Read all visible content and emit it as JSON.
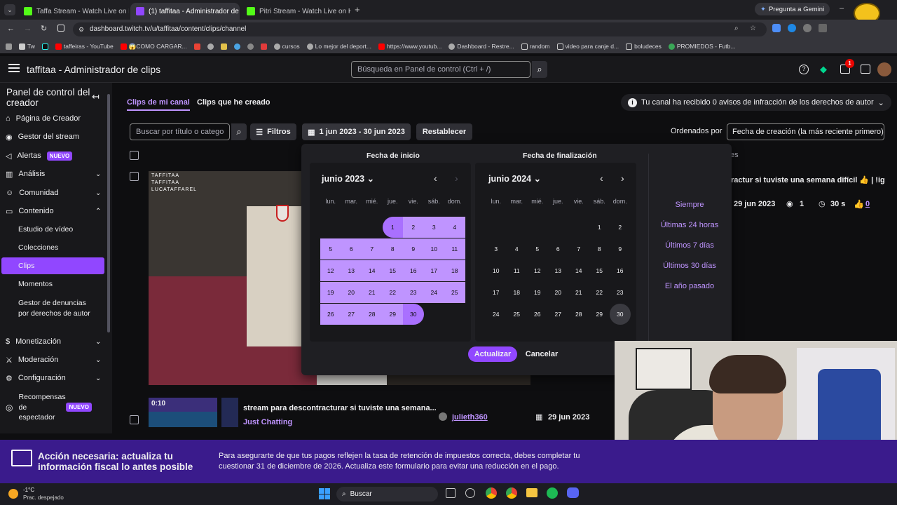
{
  "browser": {
    "tabs": [
      {
        "label": "Taffa Stream - Watch Live on Ki",
        "active": false,
        "color": "#53fc18"
      },
      {
        "label": "(1) taffitaa - Administrador de c",
        "active": true,
        "color": "#9147ff"
      },
      {
        "label": "Pitri Stream - Watch Live on Ki",
        "active": false,
        "color": "#53fc18"
      }
    ],
    "gemini_label": "Pregunta a Gemini",
    "url": "dashboard.twitch.tv/u/taffitaa/content/clips/channel",
    "bookmarks": [
      "Tw",
      "taffeiras - YouTube",
      "😱COMO CARGAR...",
      "cursos",
      "Lo mejor del deport...",
      "https://www.youtub...",
      "Dashboard - Restre...",
      "random",
      "video para canje d...",
      "boludeces",
      "PROMIEDOS - Futb..."
    ]
  },
  "topnav": {
    "title": "taffitaa - Administrador de clips",
    "search_placeholder": "Búsqueda en Panel de control (Ctrl + /)",
    "notification_count": "1"
  },
  "sidebar": {
    "title": "Panel de control del creador",
    "items": [
      {
        "label": "Página de Creador"
      },
      {
        "label": "Gestor del stream"
      },
      {
        "label": "Alertas",
        "badge": "NUEVO"
      },
      {
        "label": "Análisis"
      },
      {
        "label": "Comunidad"
      },
      {
        "label": "Contenido"
      }
    ],
    "subitems": [
      "Estudio de vídeo",
      "Colecciones",
      "Clips",
      "Momentos",
      "Gestor de denuncias por derechos de autor"
    ],
    "items2": [
      {
        "label": "Monetización"
      },
      {
        "label": "Moderación"
      },
      {
        "label": "Configuración"
      },
      {
        "label": "Recompensas de espectador",
        "badge": "NUEVO"
      }
    ]
  },
  "main": {
    "tabs": [
      "Clips de mi canal",
      "Clips que he creado"
    ],
    "copyright_notice": "Tu canal ha recibido 0 avisos de infracción de los derechos de autor",
    "search_placeholder": "Buscar por título o catego",
    "filters_label": "Filtros",
    "date_range": "1 jun 2023 - 30 jun 2023",
    "reset_label": "Restablecer",
    "sort_label": "Ordenados por",
    "sort_value": "Fecha de creación (la más reciente primero)",
    "header_fragment": "es",
    "clip1": {
      "title_fragment": "ractur si tuviste una semana difícil 👍 | !ig",
      "date": "29 jun 2023",
      "views": "1",
      "duration": "30 s",
      "likes": "0"
    },
    "clip2": {
      "duration": "0:10",
      "title": "stream para descontracturar si tuviste una semana...",
      "category": "Just Chatting",
      "creator": "julieth360",
      "date": "29 jun 2023"
    }
  },
  "calendar": {
    "start_label": "Fecha de inicio",
    "end_label": "Fecha de finalización",
    "left_month": "junio 2023",
    "right_month": "junio 2024",
    "weekdays": [
      "lun.",
      "mar.",
      "mié.",
      "jue.",
      "vie.",
      "sáb.",
      "dom."
    ],
    "left_first_weekday": 3,
    "left_days": 30,
    "right_first_weekday": 5,
    "right_days": 30,
    "selected_start": 1,
    "selected_end": 30,
    "presets": [
      "Siempre",
      "Últimas 24 horas",
      "Últimos 7 días",
      "Últimos 30 días",
      "El año pasado"
    ],
    "update_label": "Actualizar",
    "cancel_label": "Cancelar"
  },
  "banner": {
    "title": "Acción necesaria: actualiza tu información fiscal lo antes posible",
    "text": "Para asegurarte de que tus pagos reflejen la tasa de retención de impuestos correcta, debes completar tu cuestionar 31 de diciembre de 2026. Actualiza este formulario para evitar una reducción en el pago."
  },
  "taskbar": {
    "temperature": "-1°C",
    "weather": "Prac. despejado",
    "search_label": "Buscar"
  },
  "overlay": {
    "video_text": [
      "TAFFITAA",
      "TAFFITAA",
      "LUCATAFFAREL"
    ]
  },
  "colors": {
    "accent": "#9147ff",
    "range": "#bf94ff",
    "banner": "#3a1b8c"
  }
}
